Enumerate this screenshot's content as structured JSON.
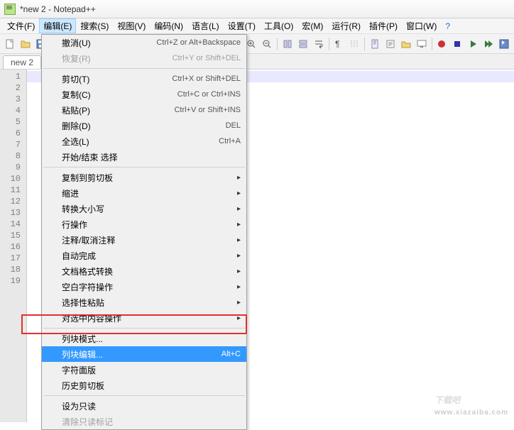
{
  "title": "*new 2 - Notepad++",
  "menubar": {
    "file": "文件(F)",
    "edit": "编辑(E)",
    "search": "搜索(S)",
    "view": "视图(V)",
    "encoding": "编码(N)",
    "language": "语言(L)",
    "settings": "设置(T)",
    "tools": "工具(O)",
    "macro": "宏(M)",
    "run": "运行(R)",
    "plugins": "插件(P)",
    "window": "窗口(W)",
    "help": "?"
  },
  "tab": {
    "name": "new 2"
  },
  "gutter_lines": [
    "1",
    "2",
    "3",
    "4",
    "5",
    "6",
    "7",
    "8",
    "9",
    "10",
    "11",
    "12",
    "13",
    "14",
    "15",
    "16",
    "17",
    "18",
    "19"
  ],
  "edit_menu": {
    "undo": {
      "label": "撤消(U)",
      "shortcut": "Ctrl+Z or Alt+Backspace"
    },
    "redo": {
      "label": "恢复(R)",
      "shortcut": "Ctrl+Y or Shift+DEL"
    },
    "cut": {
      "label": "剪切(T)",
      "shortcut": "Ctrl+X or Shift+DEL"
    },
    "copy": {
      "label": "复制(C)",
      "shortcut": "Ctrl+C or Ctrl+INS"
    },
    "paste": {
      "label": "粘贴(P)",
      "shortcut": "Ctrl+V or Shift+INS"
    },
    "delete": {
      "label": "删除(D)",
      "shortcut": "DEL"
    },
    "select_all": {
      "label": "全选(L)",
      "shortcut": "Ctrl+A"
    },
    "begin_end_select": {
      "label": "开始/结束 选择"
    },
    "copy_to_clipboard": {
      "label": "复制到剪切板"
    },
    "indent": {
      "label": "缩进"
    },
    "convert_case": {
      "label": "转换大小写"
    },
    "line_ops": {
      "label": "行操作"
    },
    "comment": {
      "label": "注释/取消注释"
    },
    "auto_complete": {
      "label": "自动完成"
    },
    "eol_conversion": {
      "label": "文档格式转换"
    },
    "blank_ops": {
      "label": "空白字符操作"
    },
    "paste_special": {
      "label": "选择性粘贴"
    },
    "on_selection": {
      "label": "对选中内容操作"
    },
    "column_mode": {
      "label": "列块模式..."
    },
    "column_editor": {
      "label": "列块编辑...",
      "shortcut": "Alt+C"
    },
    "char_panel": {
      "label": "字符面版"
    },
    "clip_history": {
      "label": "历史剪切板"
    },
    "set_readonly": {
      "label": "设为只读"
    },
    "clear_readonly": {
      "label": "清除只读标记"
    }
  },
  "watermark": {
    "big": "下载吧",
    "small": "www.xiazaiba.com"
  }
}
